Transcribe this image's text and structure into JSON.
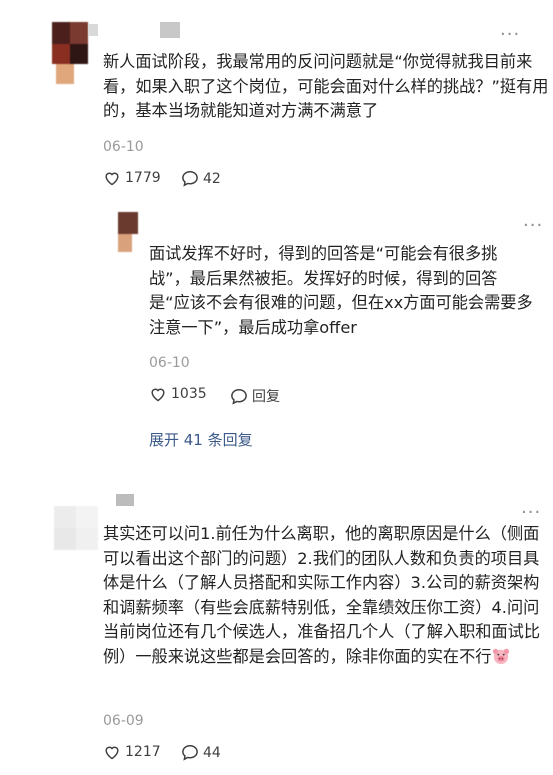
{
  "comments": [
    {
      "text": "新人面试阶段，我最常用的反问问题就是“你觉得就我目前来看，如果入职了这个岗位，可能会面对什么样的挑战？”挺有用的，基本当场就能知道对方满不满意了",
      "date": "06-10",
      "likes": "1779",
      "replies": "42"
    },
    {
      "text": "其实还可以问1.前任为什么离职，他的离职原因是什么（侧面可以看出这个部门的问题）2.我们的团队人数和负责的项目具体是什么（了解人员搭配和实际工作内容）3.公司的薪资架构和调薪频率（有些会底薪特别低，全靠绩效压你工资）4.问问当前岗位还有几个候选人，准备招几个人（了解入职和面试比例）一般来说这些都是会回答的，除非你面的实在不行",
      "date": "06-09",
      "likes": "1217",
      "replies": "44"
    }
  ],
  "reply": {
    "text": "面试发挥不好时，得到的回答是“可能会有很多挑战”，最后果然被拒。发挥好的时候，得到的回答是“应该不会有很难的问题，但在xx方面可能会需要多注意一下”，最后成功拿offer",
    "date": "06-10",
    "likes": "1035",
    "reply_label": "回复"
  },
  "expand_label": "展开 41 条回复",
  "more_glyph": "···",
  "icons": {
    "like": "heart-outline-icon",
    "comment": "comment-bubble-icon",
    "more": "more-dots-icon",
    "emoji": "pig-face-emoji-icon"
  },
  "colors": {
    "link": "#3b5a8a",
    "meta": "#9a9a9a",
    "text": "#222222"
  }
}
